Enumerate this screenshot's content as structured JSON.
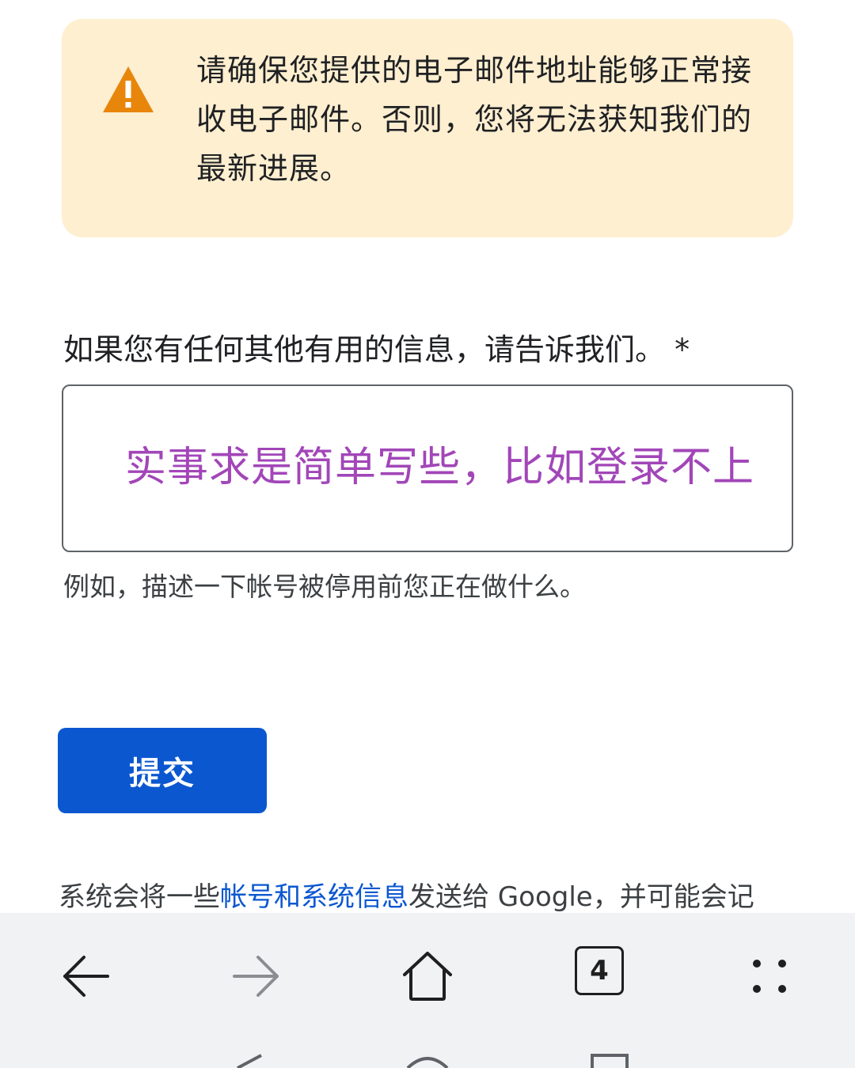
{
  "warning": {
    "icon": "warning-icon",
    "lines": [
      "请确保您提供的电子邮件地址能够正常接",
      "收电子邮件。否则，您将无法获知我们的",
      "最新进展。"
    ]
  },
  "form": {
    "label": "如果您有任何其他有用的信息，请告诉我们。 *",
    "textarea_value": "实事求是简单写些，比如登录不上",
    "hint": "例如，描述一下帐号被停用前您正在做什么。",
    "submit_label": "提交"
  },
  "footer": {
    "before": "系统会将一些",
    "link": "帐号和系统信息",
    "after": "发送给 Google，并可能会记"
  },
  "browser_nav": {
    "back_icon": "back-arrow-icon",
    "forward_icon": "forward-arrow-icon",
    "home_icon": "home-icon",
    "tab_count": "4",
    "menu_icon": "menu-dots-icon"
  },
  "colors": {
    "warning_bg": "#fdefd0",
    "warning_icon": "#e8860c",
    "primary": "#0b57d0",
    "input_text": "#a246b8"
  }
}
